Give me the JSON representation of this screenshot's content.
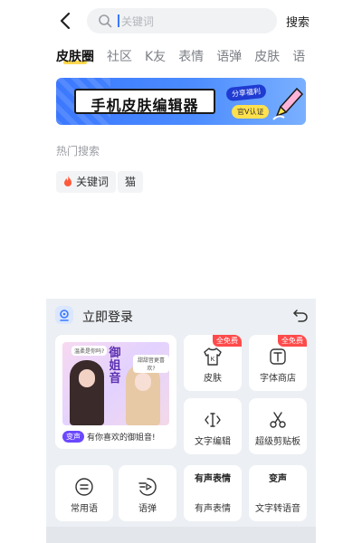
{
  "search": {
    "placeholder": "关键词",
    "button": "搜索"
  },
  "tabs": [
    {
      "label": "皮肤圈",
      "active": true
    },
    {
      "label": "社区"
    },
    {
      "label": "K友"
    },
    {
      "label": "表情"
    },
    {
      "label": "语弹"
    },
    {
      "label": "皮肤"
    },
    {
      "label": "语"
    }
  ],
  "banner": {
    "title": "手机皮肤编辑器",
    "tag1": "分享福利",
    "tag2": "官V认证"
  },
  "hot_search": {
    "title": "热门搜索",
    "chips": [
      "关键词",
      "猫"
    ]
  },
  "panel": {
    "login": "立即登录",
    "promo": {
      "big_text": "御姐音",
      "bubble1": "温柔是你吗?",
      "bubble2": "甜甜音更喜欢?",
      "tag": "变声",
      "text": "有你喜欢的御姐音!"
    },
    "badge": "全免费",
    "items": {
      "skin": "皮肤",
      "font": "字体商店",
      "edit": "文字编辑",
      "clip": "超级剪贴板",
      "phrase": "常用语",
      "danmu": "语弹",
      "voice": "有声表情",
      "voice_icon": "有声表情",
      "tts": "文字转语音",
      "tts_icon": "变声"
    }
  },
  "colors": {
    "accent": "#3a78ff",
    "tab_underline": "#ffd84d",
    "badge": "#ff4b4b"
  }
}
